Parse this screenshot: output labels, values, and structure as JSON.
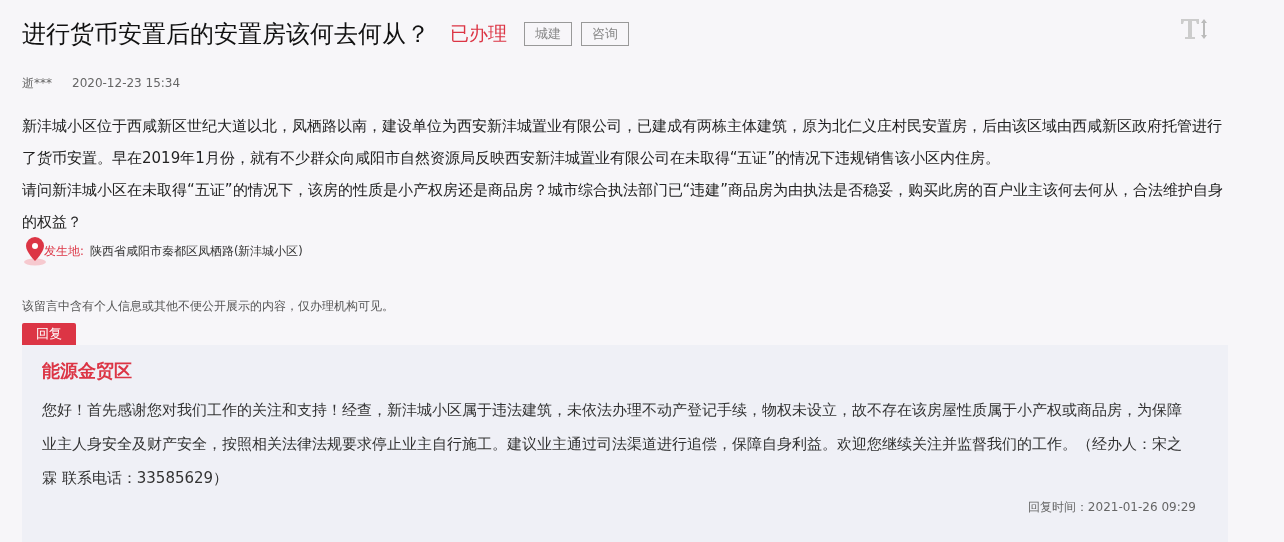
{
  "title": "进行货币安置后的安置房该何去何从？",
  "status": "已办理",
  "tags": [
    "城建",
    "咨询"
  ],
  "author": "逝***",
  "date": "2020-12-23 15:34",
  "paragraphs": [
    "新沣城小区位于西咸新区世纪大道以北，凤栖路以南，建设单位为西安新沣城置业有限公司，已建成有两栋主体建筑，原为北仁义庄村民安置房，后由该区域由西咸新区政府托管进行了货币安置。早在2019年1月份，就有不少群众向咸阳市自然资源局反映西安新沣城置业有限公司在未取得“五证”的情况下违规销售该小区内住房。",
    "请问新沣城小区在未取得“五证”的情况下，该房的性质是小产权房还是商品房？城市综合执法部门已“违建”商品房为由执法是否稳妥，购买此房的百户业主该何去何从，合法维护自身的权益？"
  ],
  "location": {
    "label": "发生地:",
    "value": "陕西省咸阳市秦都区凤栖路(新沣城小区)"
  },
  "privacy_note": "该留言中含有个人信息或其他不便公开展示的内容，仅办理机构可见。",
  "reply": {
    "tab": "回复",
    "org": "能源金贸区",
    "text": "您好！首先感谢您对我们工作的关注和支持！经查，新沣城小区属于违法建筑，未依法办理不动产登记手续，物权未设立，故不存在该房屋性质属于小产权或商品房，为保障业主人身安全及财产安全，按照相关法律法规要求停止业主自行施工。建议业主通过司法渠道进行追偿，保障自身利益。欢迎您继续关注并监督我们的工作。（经办人：宋之霖 联系电话：33585629）",
    "time": "回复时间：2021-01-26 09:29"
  }
}
